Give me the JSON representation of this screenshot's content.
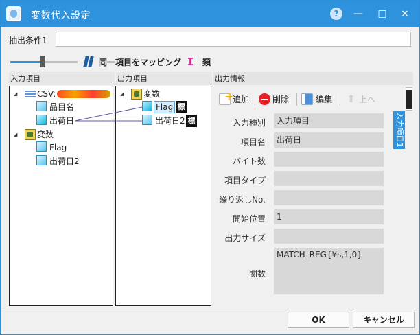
{
  "window": {
    "title": "変数代入設定",
    "help_icon": "question-circle-icon",
    "minimize_icon": "minimize-icon",
    "maximize_icon": "maximize-icon",
    "close_icon": "close-icon"
  },
  "condition": {
    "label": "抽出条件1",
    "value": ""
  },
  "mapping_controls": {
    "same_item_label": "同一項目をマッピング",
    "similar_label": "類"
  },
  "input_pane": {
    "header": "入力項目",
    "csv_label": "CSV:",
    "items": [
      "品目名",
      "出荷日"
    ],
    "variables_label": "変数",
    "variables": [
      "Flag",
      "出荷日2"
    ]
  },
  "output_pane": {
    "header": "出力項目",
    "variables_label": "変数",
    "items": [
      "Flag",
      "出荷日2"
    ],
    "standard_mark": "標"
  },
  "info_pane": {
    "header": "出力情報",
    "toolbar": {
      "add": "追加",
      "delete": "削除",
      "edit": "編集",
      "up": "上へ"
    },
    "side_tab": "入力項目1",
    "fields": [
      {
        "label": "入力種別",
        "value": "入力項目"
      },
      {
        "label": "項目名",
        "value": "出荷日"
      },
      {
        "label": "バイト数",
        "value": ""
      },
      {
        "label": "項目タイプ",
        "value": ""
      },
      {
        "label": "繰り返しNo.",
        "value": ""
      },
      {
        "label": "開始位置",
        "value": "1"
      },
      {
        "label": "出力サイズ",
        "value": ""
      },
      {
        "label": "関数",
        "value": "MATCH_REG{¥s,1,0}"
      }
    ]
  },
  "buttons": {
    "ok": "OK",
    "cancel": "キャンセル"
  },
  "colors": {
    "title_bar": "#2f92dd",
    "selection": "#d6ecff",
    "disabled_field": "#d8d8d8"
  }
}
